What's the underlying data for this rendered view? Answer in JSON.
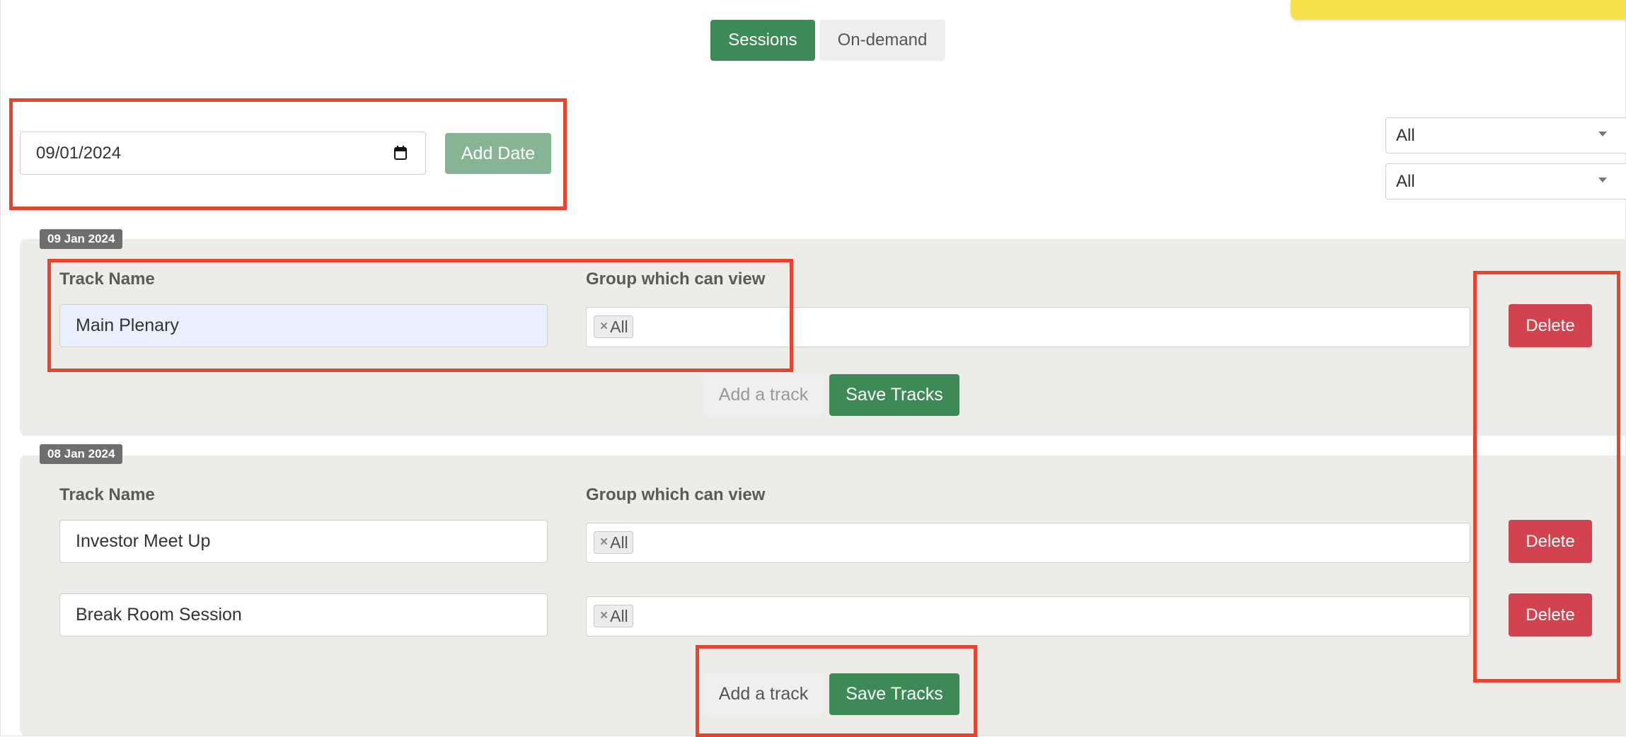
{
  "view_toggle": {
    "sessions": "Sessions",
    "on_demand": "On-demand",
    "active": "Sessions"
  },
  "add_date_form": {
    "date_value": "09/01/2024",
    "add_date_label": "Add Date"
  },
  "filters": [
    {
      "value": "All"
    },
    {
      "value": "All"
    }
  ],
  "columns": {
    "track_name": "Track Name",
    "group": "Group which can view"
  },
  "days": [
    {
      "date": "09 Jan 2024",
      "tracks": [
        {
          "name": "Main Plenary",
          "groups": [
            "All"
          ],
          "delete_label": "Delete"
        }
      ],
      "add_track_label": "Add a track",
      "save_label": "Save Tracks"
    },
    {
      "date": "08 Jan 2024",
      "tracks": [
        {
          "name": "Investor Meet Up",
          "groups": [
            "All"
          ],
          "delete_label": "Delete"
        },
        {
          "name": "Break Room Session",
          "groups": [
            "All"
          ],
          "delete_label": "Delete"
        }
      ],
      "add_track_label": "Add a track",
      "save_label": "Save Tracks"
    }
  ],
  "tag_remove_symbol": "×",
  "colors": {
    "primary_green": "#3d8a57",
    "disabled_green": "#86b495",
    "danger_red": "#d2434f",
    "annotation_red": "#e8432d",
    "panel_bg": "#edece8"
  }
}
